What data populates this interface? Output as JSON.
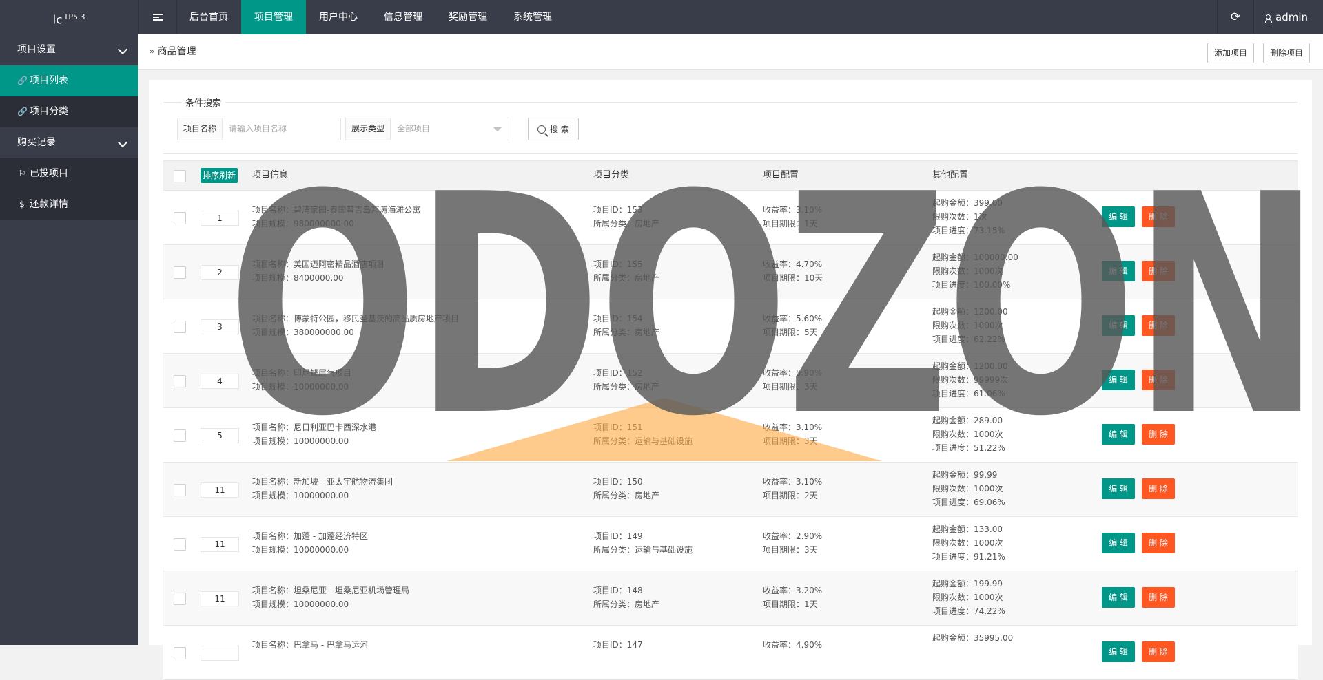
{
  "app": {
    "logo": "lc",
    "version": "TP5.3"
  },
  "topnav": [
    "后台首页",
    "项目管理",
    "用户中心",
    "信息管理",
    "奖励管理",
    "系统管理"
  ],
  "topnav_active_index": 1,
  "user": {
    "name": "admin",
    "refresh_icon": "⟳"
  },
  "sidebar": {
    "groups": [
      {
        "label": "项目设置",
        "items": [
          {
            "label": "项目列表",
            "icon": "link-icon",
            "active": true
          },
          {
            "label": "项目分类",
            "icon": "link-icon",
            "active": false
          }
        ]
      },
      {
        "label": "购买记录",
        "items": [
          {
            "label": "已投项目",
            "icon": "flag-icon",
            "active": false
          },
          {
            "label": "还款详情",
            "icon": "dollar-icon",
            "active": false
          }
        ]
      }
    ]
  },
  "breadcrumb": {
    "label": "商品管理"
  },
  "header_buttons": {
    "add": "添加项目",
    "delete": "删除项目"
  },
  "search": {
    "legend": "条件搜索",
    "name_label": "项目名称",
    "name_placeholder": "请输入项目名称",
    "type_label": "展示类型",
    "type_value": "全部项目",
    "button": "搜 索"
  },
  "table": {
    "sort_button": "排序刷新",
    "columns": [
      "项目信息",
      "项目分类",
      "项目配置",
      "其他配置"
    ],
    "edit_label": "编 辑",
    "delete_label": "删 除",
    "rows": [
      {
        "sort": "1",
        "name": "项目名称：碧湾家园-泰国普吉岛邦涛海滩公寓",
        "scale": "项目规模：980000000.00",
        "id": "项目ID：153",
        "category": "所属分类：房地产",
        "rate": "收益率：3.10%",
        "period": "项目期限：1天",
        "min": "起购金额：399.00",
        "limit": "限购次数：1次",
        "progress": "项目进度：73.15%"
      },
      {
        "sort": "2",
        "name": "项目名称：美国迈阿密精品酒店项目",
        "scale": "项目规模：8400000.00",
        "id": "项目ID：155",
        "category": "所属分类：房地产",
        "rate": "收益率：4.70%",
        "period": "项目期限：10天",
        "min": "起购金额：100000.00",
        "limit": "限购次数：1000次",
        "progress": "项目进度：100.00%"
      },
      {
        "sort": "3",
        "name": "项目名称：博蒙特公园，移民圣基茨的高品质房地产项目",
        "scale": "项目规模：380000000.00",
        "id": "项目ID：154",
        "category": "所属分类：房地产",
        "rate": "收益率：5.60%",
        "period": "项目期限：5天",
        "min": "起购金额：1200.00",
        "limit": "限购次数：1000次",
        "progress": "项目进度：62.22%"
      },
      {
        "sort": "4",
        "name": "项目名称：印尼蝶层气项目",
        "scale": "项目规模：10000000.00",
        "id": "项目ID：152",
        "category": "所属分类：房地产",
        "rate": "收益率：5.90%",
        "period": "项目期限：3天",
        "min": "起购金额：1200.00",
        "limit": "限购次数：99999次",
        "progress": "项目进度：61.06%"
      },
      {
        "sort": "5",
        "name": "项目名称：尼日利亚巴卡西深水港",
        "scale": "项目规模：10000000.00",
        "id": "项目ID：151",
        "category": "所属分类：运输与基础设施",
        "rate": "收益率：3.10%",
        "period": "项目期限：3天",
        "min": "起购金额：289.00",
        "limit": "限购次数：1000次",
        "progress": "项目进度：51.22%"
      },
      {
        "sort": "11",
        "name": "项目名称：新加坡 - 亚太宇航物流集团",
        "scale": "项目规模：10000000.00",
        "id": "项目ID：150",
        "category": "所属分类：房地产",
        "rate": "收益率：3.10%",
        "period": "项目期限：2天",
        "min": "起购金额：99.99",
        "limit": "限购次数：1000次",
        "progress": "项目进度：69.06%"
      },
      {
        "sort": "11",
        "name": "项目名称：加蓬 - 加蓬经济特区",
        "scale": "项目规模：10000000.00",
        "id": "项目ID：149",
        "category": "所属分类：运输与基础设施",
        "rate": "收益率：2.90%",
        "period": "项目期限：3天",
        "min": "起购金额：133.00",
        "limit": "限购次数：1000次",
        "progress": "项目进度：91.21%"
      },
      {
        "sort": "11",
        "name": "项目名称：坦桑尼亚 - 坦桑尼亚机场管理局",
        "scale": "项目规模：10000000.00",
        "id": "项目ID：148",
        "category": "所属分类：房地产",
        "rate": "收益率：3.20%",
        "period": "项目期限：1天",
        "min": "起购金额：199.99",
        "limit": "限购次数：1000次",
        "progress": "项目进度：74.22%"
      },
      {
        "sort": "",
        "name": "项目名称：巴拿马 - 巴拿马运河",
        "scale": "",
        "id": "项目ID：147",
        "category": "",
        "rate": "收益率：4.90%",
        "period": "",
        "min": "起购金额：35995.00",
        "limit": "",
        "progress": ""
      }
    ]
  },
  "watermark": "ODOZON",
  "colors": {
    "accent": "#009688",
    "danger": "#ff5722",
    "dark": "#393d49"
  }
}
